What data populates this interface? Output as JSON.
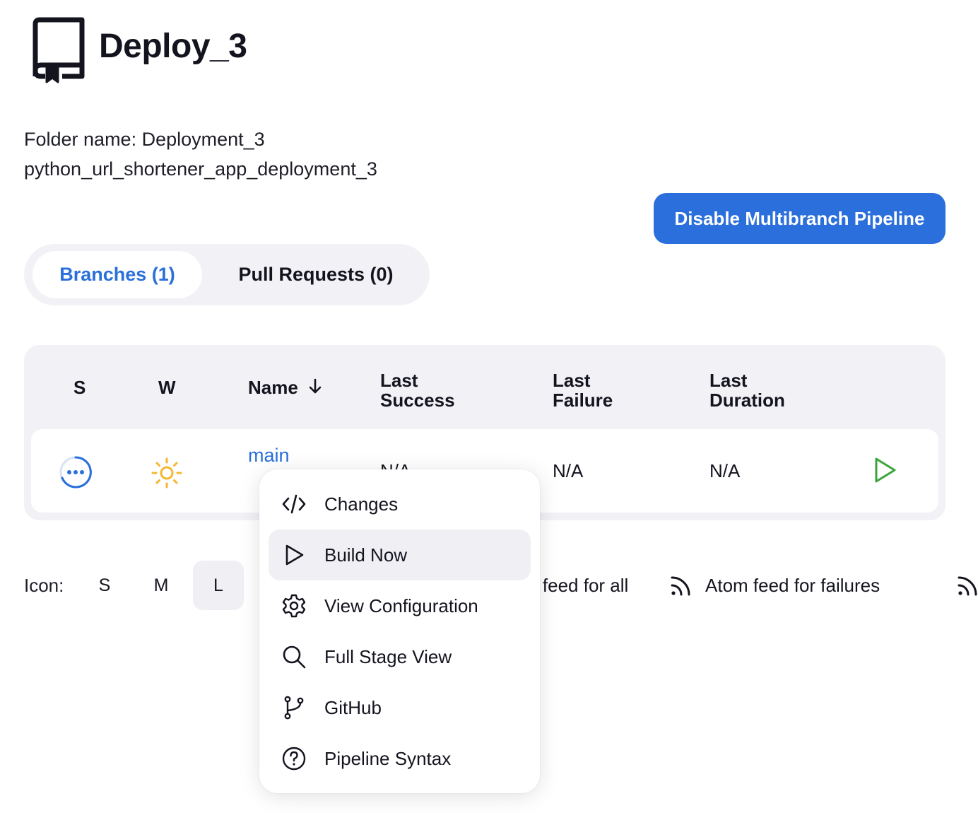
{
  "header": {
    "title": "Deploy_3",
    "folder_name": "Folder name: Deployment_3",
    "description": "python_url_shortener_app_deployment_3",
    "icon": "repository-icon"
  },
  "actions": {
    "disable_label": "Disable Multibranch Pipeline"
  },
  "tabs": [
    {
      "label": "Branches (1)",
      "active": true
    },
    {
      "label": "Pull Requests (0)",
      "active": false
    }
  ],
  "table": {
    "headers": {
      "s": "S",
      "w": "W",
      "name": "Name",
      "sort_indicator": "↓",
      "last_success": [
        "Last",
        "Success"
      ],
      "last_failure": [
        "Last",
        "Failure"
      ],
      "last_duration": [
        "Last",
        "Duration"
      ]
    },
    "rows": [
      {
        "status_icon": "in-progress-icon",
        "weather_icon": "sun-icon",
        "name": "main",
        "last_success": "N/A",
        "last_failure": "N/A",
        "last_duration": "N/A"
      }
    ]
  },
  "footer": {
    "icon_label": "Icon:",
    "sizes": [
      "S",
      "M",
      "L"
    ],
    "selected_size": "L",
    "feed_all": "Atom feed for all",
    "feed_failures": "Atom feed for failures"
  },
  "context_menu": {
    "items": [
      {
        "label": "Changes",
        "icon": "code-icon"
      },
      {
        "label": "Build Now",
        "icon": "play-icon",
        "highlighted": true
      },
      {
        "label": "View Configuration",
        "icon": "gear-icon"
      },
      {
        "label": "Full Stage View",
        "icon": "search-icon"
      },
      {
        "label": "GitHub",
        "icon": "branch-icon"
      },
      {
        "label": "Pipeline Syntax",
        "icon": "help-icon"
      }
    ]
  },
  "colors": {
    "accent": "#2a6fdb",
    "success_green": "#3aa43a",
    "sun_yellow": "#f5b731",
    "surface": "#f2f2f6"
  }
}
